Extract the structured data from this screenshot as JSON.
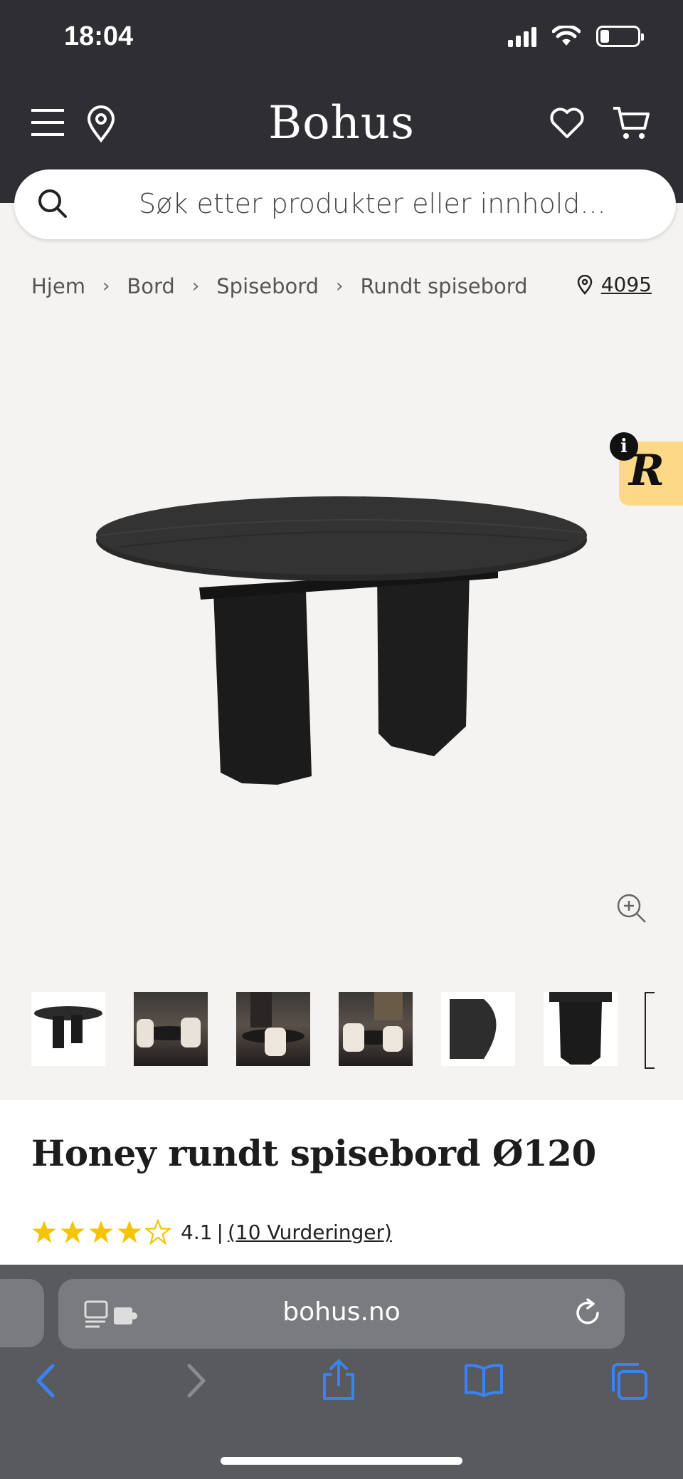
{
  "status": {
    "time": "18:04"
  },
  "header": {
    "logo": "Bohus"
  },
  "search": {
    "placeholder": "Søk etter produkter eller innhold..."
  },
  "breadcrumb": [
    "Hjem",
    "Bord",
    "Spisebord",
    "Rundt spisebord"
  ],
  "store": {
    "code": "4095"
  },
  "product": {
    "title": "Honey rundt spisebord Ø120",
    "rating_value": "4.1",
    "rating_sep": "|",
    "reviews_link": "(10 Vurderinger)",
    "stars_filled": 4,
    "stars_total": 5,
    "thumbnail_count": 6
  },
  "safari": {
    "url": "bohus.no"
  },
  "colors": {
    "header_bg": "#2f2e33",
    "star": "#f5c400",
    "badge": "#fdd987",
    "safari_bar": "#595a5e",
    "nav_blue": "#3b82f6"
  }
}
